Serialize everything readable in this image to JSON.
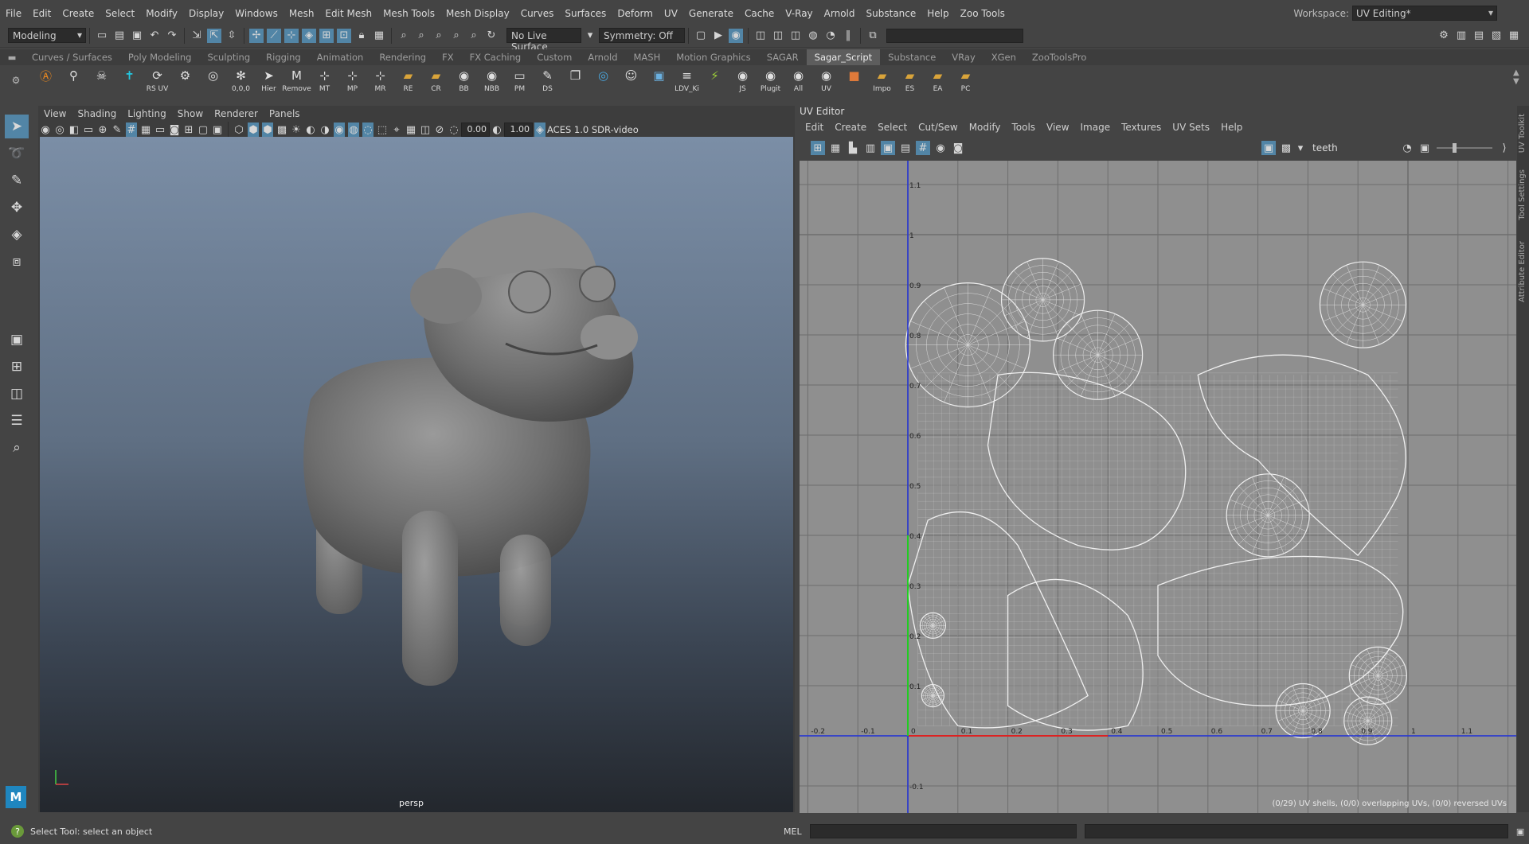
{
  "menubar": {
    "items": [
      "File",
      "Edit",
      "Create",
      "Select",
      "Modify",
      "Display",
      "Windows",
      "Mesh",
      "Edit Mesh",
      "Mesh Tools",
      "Mesh Display",
      "Curves",
      "Surfaces",
      "Deform",
      "UV",
      "Generate",
      "Cache",
      "V-Ray",
      "Arnold",
      "Substance",
      "Help",
      "Zoo Tools"
    ],
    "workspace_label": "Workspace:",
    "workspace_value": "UV Editing*"
  },
  "statusline": {
    "mode": "Modeling",
    "live_surface": "No Live Surface",
    "symmetry": "Symmetry: Off"
  },
  "shelf": {
    "tabs": [
      "Curves / Surfaces",
      "Poly Modeling",
      "Sculpting",
      "Rigging",
      "Animation",
      "Rendering",
      "FX",
      "FX Caching",
      "Custom",
      "Arnold",
      "MASH",
      "Motion Graphics",
      "SAGAR",
      "Sagar_Script",
      "Substance",
      "VRay",
      "XGen",
      "ZooToolsPro"
    ],
    "active_tab": "Sagar_Script",
    "buttons": [
      {
        "label": "",
        "icon": "arnold-icon"
      },
      {
        "label": "",
        "icon": "biped-icon"
      },
      {
        "label": "",
        "icon": "skull-icon"
      },
      {
        "label": "",
        "icon": "tpose-icon"
      },
      {
        "label": "RS UV",
        "icon": "rs-uv-icon"
      },
      {
        "label": "",
        "icon": "joint-icon"
      },
      {
        "label": "",
        "icon": "pivot-icon"
      },
      {
        "label": "0,0,0",
        "icon": "origin-icon"
      },
      {
        "label": "Hier",
        "icon": "hierarchy-icon"
      },
      {
        "label": "Remove",
        "icon": "remove-icon"
      },
      {
        "label": "MT",
        "icon": "mt-icon"
      },
      {
        "label": "MP",
        "icon": "mp-icon"
      },
      {
        "label": "MR",
        "icon": "mr-icon"
      },
      {
        "label": "RE",
        "icon": "folder-icon"
      },
      {
        "label": "CR",
        "icon": "folder-icon"
      },
      {
        "label": "BB",
        "icon": "eye-icon"
      },
      {
        "label": "NBB",
        "icon": "eye-icon"
      },
      {
        "label": "PM",
        "icon": "window-icon"
      },
      {
        "label": "DS",
        "icon": "edit-icon"
      },
      {
        "label": "",
        "icon": "copy-icon"
      },
      {
        "label": "",
        "icon": "target-icon"
      },
      {
        "label": "",
        "icon": "character-icon"
      },
      {
        "label": "",
        "icon": "cube-icon"
      },
      {
        "label": "LDV_Ki",
        "icon": "stripes-icon"
      },
      {
        "label": "",
        "icon": "bolt-icon"
      },
      {
        "label": "JS",
        "icon": "eye-icon"
      },
      {
        "label": "Plugit",
        "icon": "eye-icon"
      },
      {
        "label": "All",
        "icon": "eye-icon"
      },
      {
        "label": "UV",
        "icon": "eye-icon"
      },
      {
        "label": "",
        "icon": "orange-cube-icon"
      },
      {
        "label": "Impo",
        "icon": "folder-icon"
      },
      {
        "label": "ES",
        "icon": "folder-icon"
      },
      {
        "label": "EA",
        "icon": "folder-icon"
      },
      {
        "label": "PC",
        "icon": "folder-icon"
      }
    ]
  },
  "viewport": {
    "menu": [
      "View",
      "Shading",
      "Lighting",
      "Show",
      "Renderer",
      "Panels"
    ],
    "exposure": "0.00",
    "gamma": "1.00",
    "color_space": "ACES 1.0 SDR-video",
    "camera_label": "persp"
  },
  "uv_editor": {
    "title": "UV Editor",
    "menu": [
      "Edit",
      "Create",
      "Select",
      "Cut/Sew",
      "Modify",
      "Tools",
      "View",
      "Image",
      "Textures",
      "UV Sets",
      "Help"
    ],
    "texture_name": "teeth",
    "x_ticks": [
      "-0.2",
      "-0.1",
      "0",
      "0.1",
      "0.2",
      "0.3",
      "0.4",
      "0.5",
      "0.6",
      "0.7",
      "0.8",
      "0.9",
      "1",
      "1.1"
    ],
    "y_ticks": [
      "1.1",
      "1",
      "0.9",
      "0.8",
      "0.7",
      "0.6",
      "0.5",
      "0.4",
      "0.3",
      "0.2",
      "0.1",
      "-0.1"
    ],
    "status": "(0/29) UV shells, (0/0) overlapping UVs, (0/0) reversed UVs"
  },
  "right_tabs": [
    "UV Toolkit",
    "Tool Settings",
    "Attribute Editor"
  ],
  "helpline": {
    "text": "Select Tool: select an object"
  },
  "cmdline": {
    "label": "MEL"
  },
  "colors": {
    "accent": "#5285a6",
    "uv_axis_blue": "#2233dd",
    "uv_axis_red": "#dd2222",
    "uv_axis_green": "#22cc22"
  }
}
